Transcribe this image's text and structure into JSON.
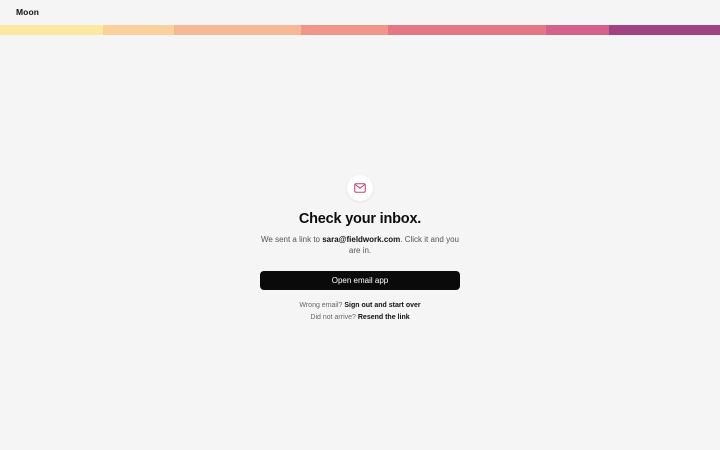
{
  "brand": {
    "name": "Moon"
  },
  "stripe": {
    "colors": [
      "#fbe8a2",
      "#fad19b",
      "#f6b795",
      "#ef9589",
      "#e47785",
      "#d4618a",
      "#a04283"
    ]
  },
  "icon": {
    "name": "mail-icon",
    "color": "#c0406e"
  },
  "main": {
    "title": "Check your inbox.",
    "subtitle_prefix": "We sent a link to ",
    "email": "sara@fieldwork.com",
    "subtitle_suffix": ". Click it and you are in.",
    "primary_button": "Open email app"
  },
  "help": {
    "wrong_email_text": "Wrong email?",
    "wrong_email_link": "Sign out and start over",
    "not_arrived_text": "Did not arrive?",
    "not_arrived_link": "Resend the link"
  }
}
